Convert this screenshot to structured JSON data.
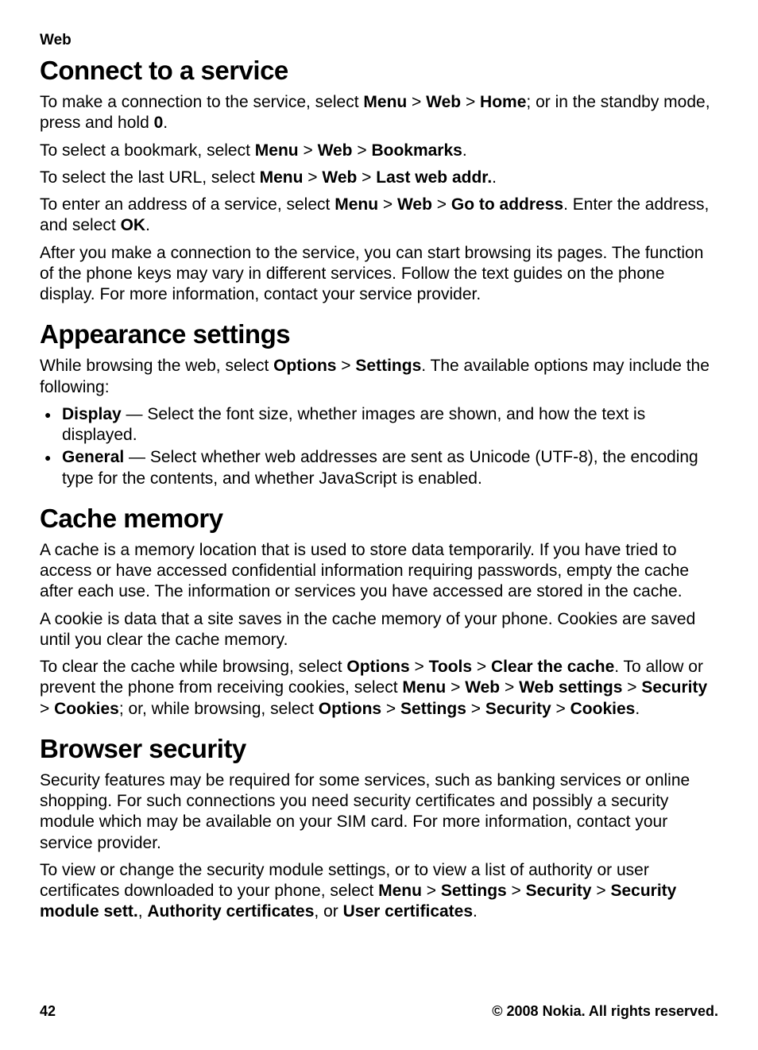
{
  "header": "Web",
  "sections": {
    "connect": {
      "title": "Connect to a service",
      "p1": {
        "t1": "To make a connection to the service, select ",
        "b1": "Menu",
        "sep": " > ",
        "b2": "Web",
        "b3": "Home",
        "t2": "; or in the standby mode, press and hold ",
        "b4": "0",
        "t3": "."
      },
      "p2": {
        "t1": "To select a bookmark, select ",
        "b1": "Menu",
        "b2": "Web",
        "b3": "Bookmarks",
        "t2": "."
      },
      "p3": {
        "t1": "To select the last URL, select ",
        "b1": "Menu",
        "b2": "Web",
        "b3": "Last web addr.",
        "t2": "."
      },
      "p4": {
        "t1": "To enter an address of a service, select ",
        "b1": "Menu",
        "b2": "Web",
        "b3": "Go to address",
        "t2": ". Enter the address, and select ",
        "b4": "OK",
        "t3": "."
      },
      "p5": "After you make a connection to the service, you can start browsing its pages. The function of the phone keys may vary in different services. Follow the text guides on the phone display. For more information, contact your service provider."
    },
    "appearance": {
      "title": "Appearance settings",
      "p1": {
        "t1": "While browsing the web, select ",
        "b1": "Options",
        "b2": "Settings",
        "t2": ". The available options may include the following:"
      },
      "li1": {
        "b1": "Display",
        "t1": "  — Select the font size, whether images are shown, and how the text is displayed."
      },
      "li2": {
        "b1": "General",
        "t1": "  — Select whether web addresses are sent as Unicode (UTF-8), the encoding type for the contents, and whether JavaScript is enabled."
      }
    },
    "cache": {
      "title": "Cache memory",
      "p1": "A cache is a memory location that is used to store data temporarily. If you have tried to access or have accessed confidential information requiring passwords, empty the cache after each use. The information or services you have accessed are stored in the cache.",
      "p2": "A cookie is data that a site saves in the cache memory of your phone. Cookies are saved until you clear the cache memory.",
      "p3": {
        "t1": "To clear the cache while browsing, select ",
        "b1": "Options",
        "b2": "Tools",
        "b3": "Clear the cache",
        "t2": ". To allow or prevent the phone from receiving cookies, select ",
        "b4": "Menu",
        "b5": "Web",
        "b6": "Web settings",
        "b7": "Security",
        "b8": "Cookies",
        "t3": "; or, while browsing, select ",
        "b9": "Options",
        "b10": "Settings",
        "b11": "Security",
        "b12": "Cookies",
        "t4": "."
      }
    },
    "security": {
      "title": "Browser security",
      "p1": "Security features may be required for some services, such as banking services or online shopping. For such connections you need security certificates and possibly a security module which may be available on your SIM card. For more information, contact your service provider.",
      "p2": {
        "t1": "To view or change the security module settings, or to view a list of authority or user certificates downloaded to your phone, select ",
        "b1": "Menu",
        "b2": "Settings",
        "b3": "Security",
        "b4": "Security module sett.",
        "t2": ", ",
        "b5": "Authority certificates",
        "t3": ", or ",
        "b6": "User certificates",
        "t4": "."
      }
    }
  },
  "footer": {
    "page": "42",
    "copyright": "© 2008 Nokia. All rights reserved."
  },
  "sep": " > "
}
